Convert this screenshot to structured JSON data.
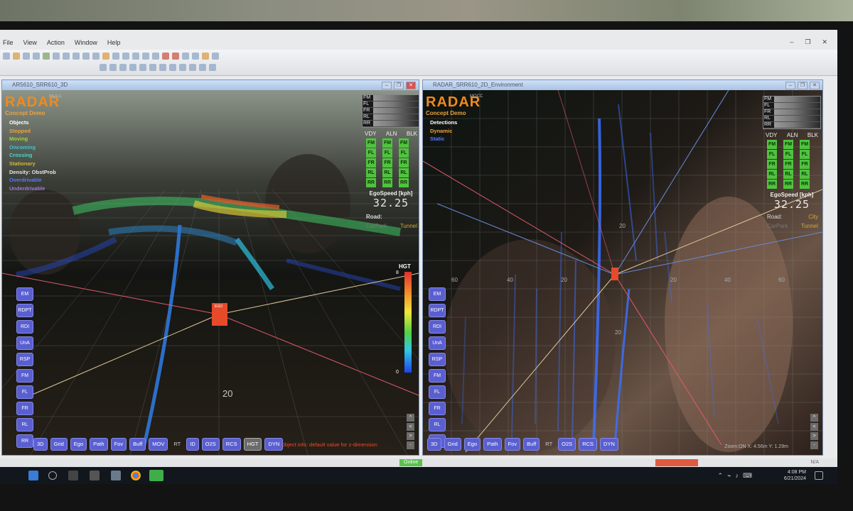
{
  "app": {
    "menu": [
      "File",
      "View",
      "Action",
      "Window",
      "Help"
    ],
    "window_controls": [
      "–",
      "❐",
      "✕"
    ]
  },
  "left_panel": {
    "title": "AR5610_SRR610_3D",
    "logo": "RADAR",
    "logo_sub": "Concept Demo",
    "mocc": "MOCC",
    "legend": [
      {
        "text": "Objects",
        "color": "#ffffff"
      },
      {
        "text": "Stopped",
        "color": "#f0a23c"
      },
      {
        "text": "Moving",
        "color": "#9ed63a"
      },
      {
        "text": "Oncoming",
        "color": "#3ec4d6"
      },
      {
        "text": "Crossing",
        "color": "#4fd4c8"
      },
      {
        "text": "Stationary",
        "color": "#d4b83a"
      },
      {
        "text": "Density: ObstProb",
        "color": "#e6e6e6"
      },
      {
        "text": "Overdrivable",
        "color": "#5a78ff"
      },
      {
        "text": "Underdrivable",
        "color": "#a07ad8"
      }
    ],
    "radar_labels": [
      "FM",
      "FL",
      "FR",
      "RL",
      "RR"
    ],
    "radar_cols": [
      "VDY",
      "ALN",
      "BLK"
    ],
    "ego_label": "EgoSpeed [kph]",
    "ego_value": "32.25",
    "road_label": "Road:",
    "road_left": "CarPark",
    "road_right": "Tunnel",
    "hgt_label": "HGT",
    "hgt_max": "8",
    "hgt_min": "0",
    "grid_label": "20",
    "ego_marker": "EGO",
    "side_buttons": [
      "EM",
      "RDPT",
      "RDI",
      "UnA",
      "RSP",
      "FM",
      "FL",
      "FR",
      "RL",
      "RR"
    ],
    "bottom_buttons": [
      "3D",
      "Grid",
      "Ego",
      "Path",
      "Fov",
      "Buff",
      "MOV",
      "RT",
      "ID",
      "O2S",
      "RCS",
      "HGT",
      "DYN"
    ],
    "object_info": "Object info: default value for z-dimension",
    "scroll_buttons": [
      "^",
      "<",
      ">",
      "-"
    ]
  },
  "right_panel": {
    "title": "RADAR_SRR610_2D_Environment",
    "logo": "RADAR",
    "logo_sub": "Concept Demo",
    "mocc": "MOCC",
    "legend": [
      {
        "text": "Detections",
        "color": "#ffffff"
      },
      {
        "text": "Dynamic",
        "color": "#f0a23c"
      },
      {
        "text": "Static",
        "color": "#5a78ff"
      }
    ],
    "radar_labels": [
      "FM",
      "FL",
      "FR",
      "RL",
      "RR"
    ],
    "radar_cols": [
      "VDY",
      "ALN",
      "BLK"
    ],
    "ego_label": "EgoSpeed [kph]",
    "ego_value": "32.25",
    "road_label": "Road:",
    "road_left": "City",
    "road_right": "Tunnel",
    "road_left2": "CarPark",
    "axis_ticks": [
      "60",
      "40",
      "20",
      "20",
      "40",
      "60"
    ],
    "vertical_ticks": [
      "20",
      "20"
    ],
    "side_buttons": [
      "EM",
      "RDPT",
      "RDI",
      "UnA",
      "RSP",
      "FM",
      "FL",
      "FR",
      "RL",
      "RR"
    ],
    "bottom_buttons": [
      "3D",
      "Grid",
      "Ego",
      "Path",
      "Fov",
      "Buff",
      "RT",
      "O2S",
      "RCS",
      "DYN"
    ],
    "zoom_readout": "Zoom:ON X: 4.56m Y: 1.29m",
    "scroll_buttons": [
      "^",
      "<",
      ">",
      "-"
    ]
  },
  "statusbar": {
    "green_text": "Online",
    "green_color": "#5ac04e",
    "red_color": "#e05a40",
    "na": "N/A"
  },
  "taskbar": {
    "time": "4:08 PM",
    "date": "6/21/2024"
  }
}
